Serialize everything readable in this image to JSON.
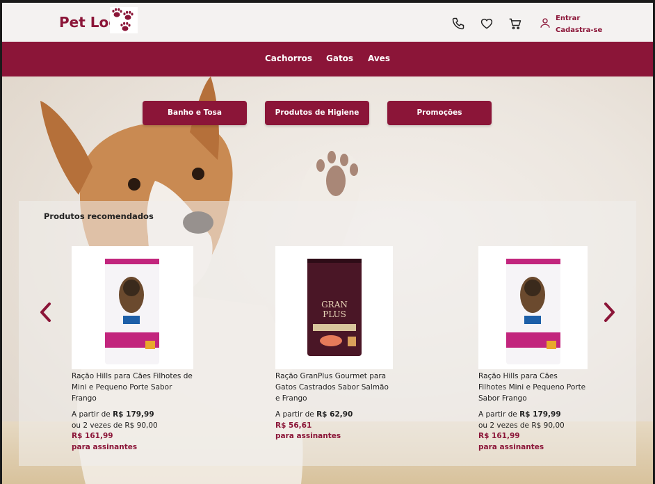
{
  "header": {
    "logo_text": "Pet Log",
    "auth": {
      "login": "Entrar",
      "signup": "Cadastra-se"
    },
    "icons": [
      "phone-icon",
      "heart-icon",
      "cart-icon",
      "user-icon"
    ]
  },
  "nav": {
    "items": [
      "Cachorros",
      "Gatos",
      "Aves"
    ]
  },
  "quick_links": [
    "Banho e Tosa",
    "Produtos de Higiene",
    "Promoções"
  ],
  "recommended": {
    "title": "Produtos recomendados",
    "products": [
      {
        "name": "Ração Hills para Cães Filhotes de Mini e Pequeno Porte Sabor Frango",
        "price_prefix": "A partir de ",
        "price": "R$ 179,99",
        "installments": "ou 2 vezes de R$ 90,00",
        "subscriber_price": "R$ 161,99",
        "subscriber_label": "para assinantes"
      },
      {
        "name": "Ração GranPlus Gourmet para Gatos Castrados Sabor Salmão e Frango",
        "price_prefix": "A partir de ",
        "price": "R$ 62,90",
        "installments": "",
        "subscriber_price": "R$ 56,61",
        "subscriber_label": "para assinantes"
      },
      {
        "name": "Ração Hills para Cães Filhotes Mini e Pequeno Porte Sabor Frango",
        "price_prefix": "A partir de ",
        "price": "R$ 179,99",
        "installments": "ou 2 vezes de R$ 90,00",
        "subscriber_price": "R$ 161,99",
        "subscriber_label": "para assinantes"
      }
    ]
  },
  "colors": {
    "brand": "#8b1538",
    "header_bg": "#f4f2f1"
  }
}
